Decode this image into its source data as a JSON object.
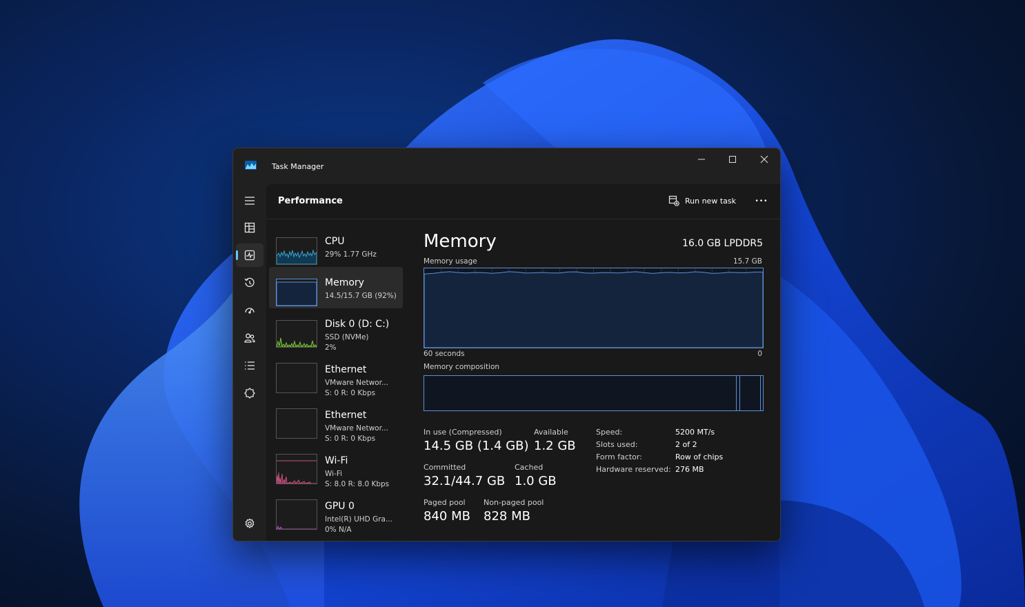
{
  "window": {
    "title": "Task Manager"
  },
  "icons": {
    "app": "task-manager-icon",
    "minimize": "minimize-icon",
    "maximize": "maximize-icon",
    "close": "close-icon",
    "nav": [
      "hamburger-icon",
      "processes-icon",
      "performance-icon",
      "history-icon",
      "startup-icon",
      "users-icon",
      "details-icon",
      "services-icon",
      "settings-icon"
    ],
    "run": "run-new-task-icon"
  },
  "colors": {
    "accent": "#60cdff",
    "memory_line": "#5d8fd3",
    "cpu_line": "#3aa7d6",
    "disk_line": "#7ec63a",
    "wifi_line": "#c2517e",
    "gpu_line": "#b04ec2"
  },
  "header": {
    "title": "Performance",
    "run_task": "Run new task",
    "more": "•••"
  },
  "perf_items": [
    {
      "name": "CPU",
      "line1": "29%  1.77 GHz",
      "line2": ""
    },
    {
      "name": "Memory",
      "line1": "14.5/15.7 GB (92%)",
      "line2": ""
    },
    {
      "name": "Disk 0 (D: C:)",
      "line1": "SSD (NVMe)",
      "line2": "2%"
    },
    {
      "name": "Ethernet",
      "line1": "VMware Networ...",
      "line2": "S: 0  R: 0 Kbps"
    },
    {
      "name": "Ethernet",
      "line1": "VMware Networ...",
      "line2": "S: 0  R: 0 Kbps"
    },
    {
      "name": "Wi-Fi",
      "line1": "Wi-Fi",
      "line2": "S: 8.0  R: 8.0 Kbps"
    },
    {
      "name": "GPU 0",
      "line1": "Intel(R) UHD Gra...",
      "line2": "0%  N/A"
    }
  ],
  "detail": {
    "title": "Memory",
    "type": "16.0 GB LPDDR5",
    "usage_label": "Memory usage",
    "usage_max": "15.7 GB",
    "axis_left": "60 seconds",
    "axis_right": "0",
    "composition_label": "Memory composition",
    "usage_fraction": 0.92,
    "composition": {
      "in_use": 14.5,
      "modified": 0.1,
      "standby": 1.0,
      "free": 0.1,
      "total": 15.7
    },
    "stats": {
      "in_use_label": "In use (Compressed)",
      "in_use": "14.5 GB (1.4 GB)",
      "available_label": "Available",
      "available": "1.2 GB",
      "committed_label": "Committed",
      "committed": "32.1/44.7 GB",
      "cached_label": "Cached",
      "cached": "1.0 GB",
      "paged_label": "Paged pool",
      "paged": "840 MB",
      "nonpaged_label": "Non-paged pool",
      "nonpaged": "828 MB"
    },
    "specs": [
      {
        "key": "Speed:",
        "value": "5200 MT/s"
      },
      {
        "key": "Slots used:",
        "value": "2 of 2"
      },
      {
        "key": "Form factor:",
        "value": "Row of chips"
      },
      {
        "key": "Hardware reserved:",
        "value": "276 MB"
      }
    ]
  }
}
